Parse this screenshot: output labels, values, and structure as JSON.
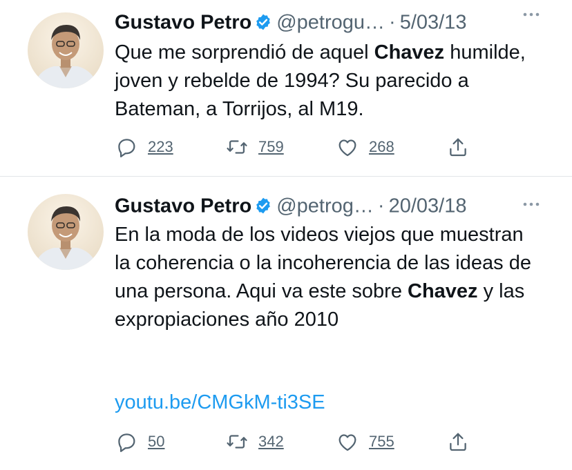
{
  "tweets": [
    {
      "author_name": "Gustavo Petro",
      "handle": "@petrogu…",
      "separator": "·",
      "date": "5/03/13",
      "text_before": "Que me sorprendió de aquel ",
      "text_bold": "Chavez",
      "text_after": " humilde, joven y rebelde de 1994? Su parecido a Bateman, a Torrijos, al M19.",
      "link": "",
      "replies": "223",
      "retweets": "759",
      "likes": "268"
    },
    {
      "author_name": "Gustavo Petro",
      "handle": "@petrog…",
      "separator": "·",
      "date": "20/03/18",
      "text_before": "En la moda de los videos viejos que muestran la coherencia o la incoherencia de las ideas de una persona. Aqui va este sobre ",
      "text_bold": "Chavez",
      "text_after": " y las expropiaciones año 2010",
      "link": "youtu.be/CMGkM-ti3SE",
      "replies": "50",
      "retweets": "342",
      "likes": "755"
    }
  ],
  "icons": {
    "verified": "verified-badge-icon",
    "more": "more-options-icon",
    "reply": "reply-icon",
    "retweet": "retweet-icon",
    "like": "like-icon",
    "share": "share-icon"
  },
  "colors": {
    "verified_blue": "#1d9bf0",
    "link_blue": "#1d9bf0",
    "secondary_text": "#536471"
  }
}
